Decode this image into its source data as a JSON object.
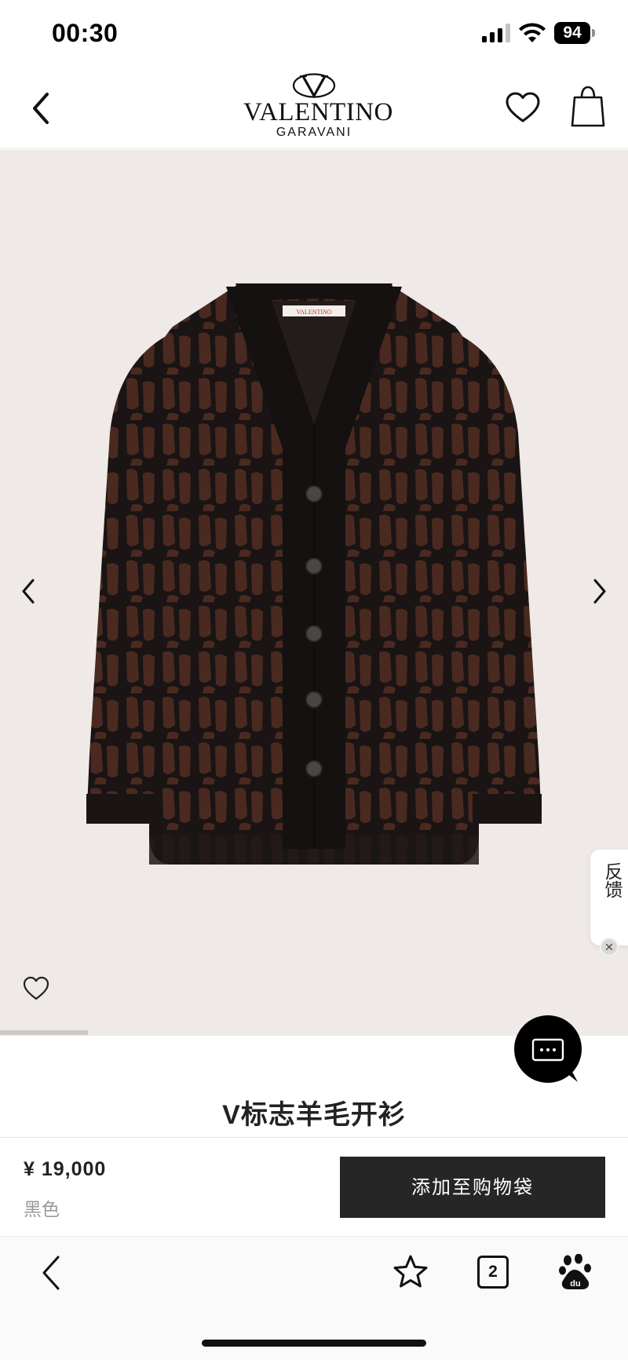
{
  "status_bar": {
    "time": "00:30",
    "battery": "94"
  },
  "header": {
    "brand_name": "VALENTINO",
    "brand_sub": "GARAVANI",
    "icons": {
      "back": "chevron-left-icon",
      "wishlist": "heart-icon",
      "bag": "shopping-bag-icon"
    }
  },
  "gallery": {
    "progress_fraction": 0.14,
    "icons": {
      "prev": "chevron-left-icon",
      "next": "chevron-right-icon",
      "wishlist": "heart-icon"
    },
    "label_tag": "VALENTINO"
  },
  "feedback": {
    "label": "反馈"
  },
  "chat": {
    "icon": "chat-bubble-icon"
  },
  "product": {
    "title": "V标志羊毛开衫",
    "price": "¥ 19,000",
    "color": "黑色",
    "add_to_bag": "添加至购物袋"
  },
  "browser_bar": {
    "tabs_count": "2"
  },
  "colors": {
    "gallery_bg": "#efe9e7",
    "button_bg": "#262626",
    "knit_dark": "#1a1414",
    "knit_brown": "#4a2a20"
  }
}
